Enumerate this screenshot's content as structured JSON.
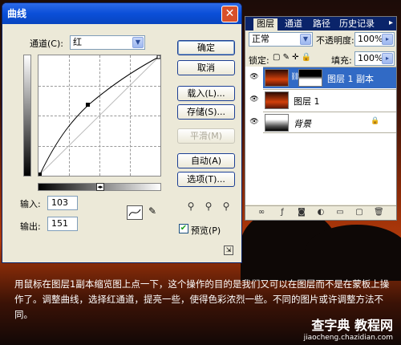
{
  "curves": {
    "title": "曲线",
    "channel_label": "通道(C):",
    "channel_value": "红",
    "input_label": "输入:",
    "input_value": "103",
    "output_label": "输出:",
    "output_value": "151",
    "preview_label": "预览(P)",
    "buttons": {
      "ok": "确定",
      "cancel": "取消",
      "load": "载入(L)...",
      "save": "存储(S)...",
      "smooth": "平滑(M)",
      "auto": "自动(A)",
      "options": "选项(T)..."
    }
  },
  "layers": {
    "tabs": [
      "图层",
      "通道",
      "路径",
      "历史记录"
    ],
    "blend_mode": "正常",
    "opacity_label": "不透明度:",
    "opacity_value": "100%",
    "lock_label": "锁定:",
    "fill_label": "填充:",
    "fill_value": "100%",
    "items": [
      {
        "name": "图层 1 副本"
      },
      {
        "name": "图层 1"
      },
      {
        "name": "背景"
      }
    ]
  },
  "caption": "用鼠标在图层1副本缩览图上点一下，这个操作的目的是我们又可以在图层而不是在蒙板上操作了。调整曲线，选择红通道，提亮一些，使得色彩浓烈一些。不同的图片或许调整方法不同。",
  "watermark": {
    "main": "查字典 教程网",
    "url": "jiaocheng.chazidian.com"
  }
}
